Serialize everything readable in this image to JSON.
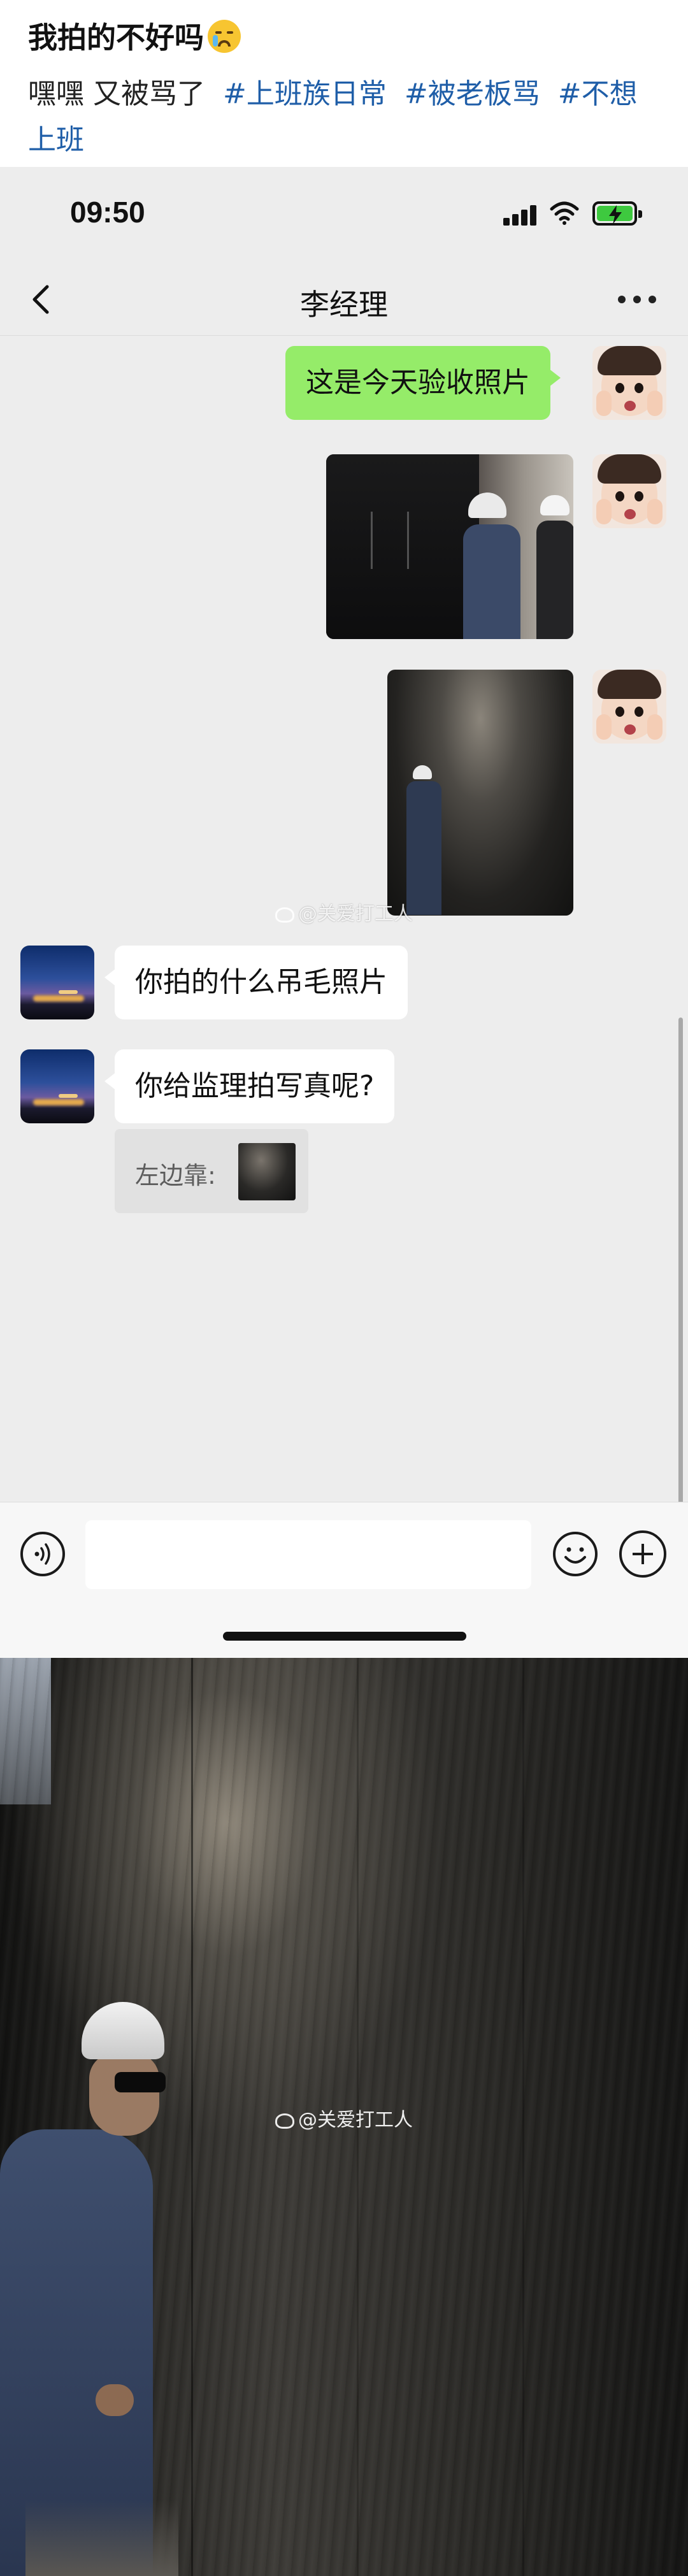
{
  "post": {
    "title": "我拍的不好吗",
    "title_emoji": "crying-face-emoji",
    "body_text": "嘿嘿 又被骂了",
    "tags": [
      "#上班族日常",
      "#被老板骂",
      "#不想上班"
    ]
  },
  "status_bar": {
    "time": "09:50",
    "battery_color": "#3ec93f"
  },
  "nav": {
    "back_icon": "chevron-left-icon",
    "title": "李经理",
    "more_icon": "more-dots-icon"
  },
  "messages": [
    {
      "from": "me",
      "type": "text",
      "text": "这是今天验收照片"
    },
    {
      "from": "me",
      "type": "image",
      "description_icon": "photo-workers-wall"
    },
    {
      "from": "me",
      "type": "image",
      "description_icon": "photo-man-by-wall"
    },
    {
      "from": "them",
      "type": "text",
      "text": "你拍的什么吊毛照片"
    },
    {
      "from": "them",
      "type": "text",
      "text": "你给监理拍写真呢?"
    }
  ],
  "quote": {
    "text": "左边靠:"
  },
  "watermark": {
    "text": "@关爱打工人"
  },
  "colors": {
    "my_bubble": "#95ec69",
    "their_bubble": "#ffffff",
    "chat_bg": "#ededed",
    "tag_link": "#1f5ea8"
  }
}
